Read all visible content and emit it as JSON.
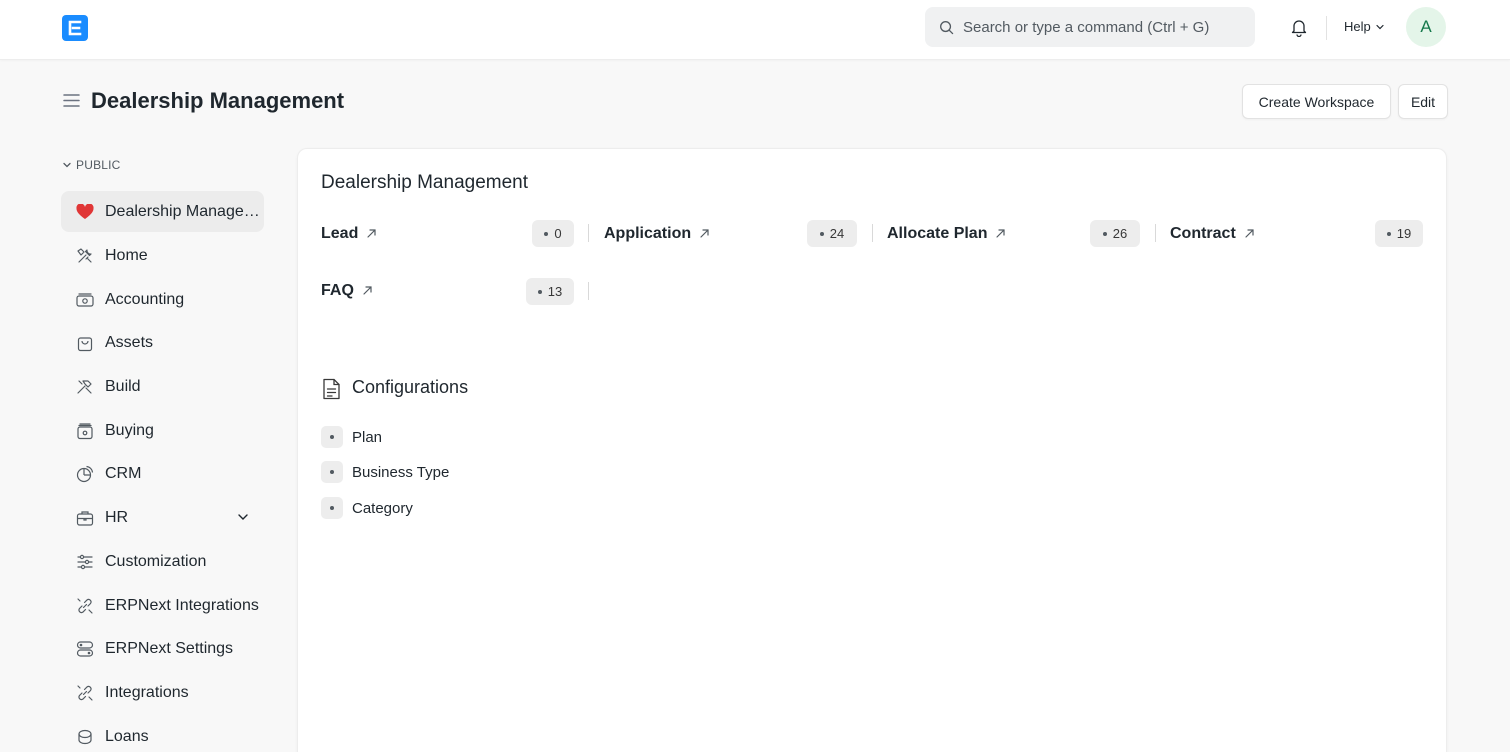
{
  "navbar": {
    "search_placeholder": "Search or type a command (Ctrl + G)",
    "help_label": "Help",
    "avatar_initial": "A"
  },
  "page": {
    "title": "Dealership Management",
    "create_workspace_label": "Create Workspace",
    "edit_label": "Edit"
  },
  "sidebar": {
    "section_label": "PUBLIC",
    "items": [
      {
        "label": "Dealership Management",
        "icon": "heart-icon",
        "active": true
      },
      {
        "label": "Home",
        "icon": "tools-icon"
      },
      {
        "label": "Accounting",
        "icon": "money-icon"
      },
      {
        "label": "Assets",
        "icon": "bag-icon"
      },
      {
        "label": "Build",
        "icon": "hammer-icon"
      },
      {
        "label": "Buying",
        "icon": "wallet-icon"
      },
      {
        "label": "CRM",
        "icon": "pie-icon"
      },
      {
        "label": "HR",
        "icon": "briefcase-icon",
        "expandable": true
      },
      {
        "label": "Customization",
        "icon": "sliders-icon"
      },
      {
        "label": "ERPNext Integrations",
        "icon": "link-icon"
      },
      {
        "label": "ERPNext Settings",
        "icon": "settings-icon"
      },
      {
        "label": "Integrations",
        "icon": "link-icon"
      },
      {
        "label": "Loans",
        "icon": "coins-icon"
      }
    ]
  },
  "main": {
    "title": "Dealership Management",
    "shortcuts": [
      {
        "label": "Lead",
        "count": "0"
      },
      {
        "label": "Application",
        "count": "24"
      },
      {
        "label": "Allocate Plan",
        "count": "26"
      },
      {
        "label": "Contract",
        "count": "19"
      },
      {
        "label": "FAQ",
        "count": "13"
      }
    ],
    "configurations": {
      "title": "Configurations",
      "links": [
        "Plan",
        "Business Type",
        "Category"
      ]
    }
  },
  "colors": {
    "brand": "#1a8cff",
    "heart": "#e03636",
    "avatar_bg": "#e4f5e9",
    "avatar_text": "#16794c"
  }
}
